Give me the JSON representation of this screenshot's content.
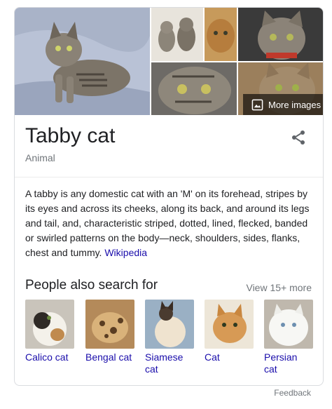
{
  "panel": {
    "title": "Tabby cat",
    "subtitle": "Animal",
    "more_images_label": "More images",
    "description": "A tabby is any domestic cat with an 'M' on its forehead, stripes by its eyes and across its cheeks, along its back, and around its legs and tail, and, characteristic striped, dotted, lined, flecked, banded or swirled patterns on the body—neck, shoulders, sides, flanks, chest and tummy.",
    "source_link": "Wikipedia",
    "share_icon": "share-icon"
  },
  "people_also_search": {
    "heading": "People also search for",
    "view_more": "View 15+ more",
    "items": [
      {
        "label": "Calico cat"
      },
      {
        "label": "Bengal cat"
      },
      {
        "label": "Siamese cat"
      },
      {
        "label": "Cat"
      },
      {
        "label": "Persian cat"
      }
    ]
  },
  "footer": {
    "feedback": "Feedback"
  },
  "colors": {
    "link": "#1a0dab",
    "muted": "#70757a",
    "border": "#dadce0"
  }
}
